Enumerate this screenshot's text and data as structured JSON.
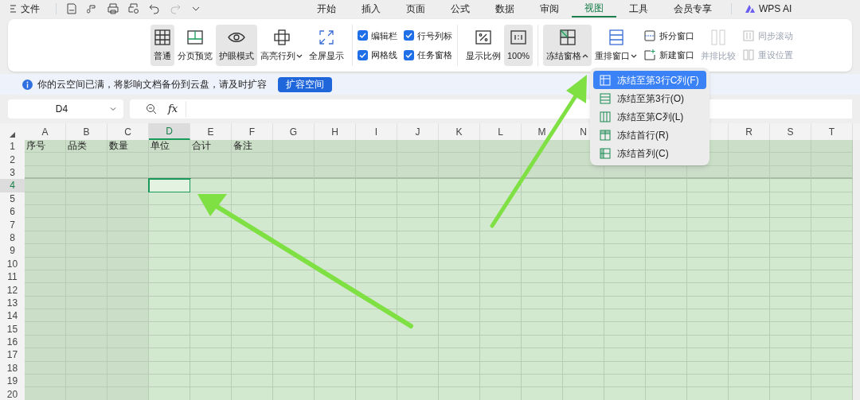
{
  "menubar": {
    "file_label": "文件",
    "tabs": [
      {
        "label": "开始",
        "selected": false
      },
      {
        "label": "插入",
        "selected": false
      },
      {
        "label": "页面",
        "selected": false
      },
      {
        "label": "公式",
        "selected": false
      },
      {
        "label": "数据",
        "selected": false
      },
      {
        "label": "审阅",
        "selected": false
      },
      {
        "label": "视图",
        "selected": true
      },
      {
        "label": "工具",
        "selected": false
      },
      {
        "label": "会员专享",
        "selected": false
      }
    ],
    "ai_label": "WPS AI"
  },
  "ribbon": {
    "view_buttons": [
      {
        "kind": "grid",
        "label": "普通",
        "selected": true,
        "dropdown": false
      },
      {
        "kind": "page",
        "label": "分页预览",
        "selected": false,
        "dropdown": false
      },
      {
        "kind": "eye",
        "label": "护眼模式",
        "selected": true,
        "dropdown": false
      },
      {
        "kind": "cross",
        "label": "高亮行列",
        "selected": false,
        "dropdown": true
      },
      {
        "kind": "expand",
        "label": "全屏显示",
        "selected": false,
        "dropdown": false
      }
    ],
    "checkboxes": [
      {
        "label": "编辑栏",
        "checked": true
      },
      {
        "label": "网格线",
        "checked": true
      },
      {
        "label": "行号列标",
        "checked": true
      },
      {
        "label": "任务窗格",
        "checked": true
      }
    ],
    "zoom_buttons": [
      {
        "kind": "percent",
        "label": "显示比例",
        "selected": false
      },
      {
        "kind": "ratio",
        "label": "100%",
        "selected": true
      }
    ],
    "window_buttons": [
      {
        "kind": "freeze",
        "label": "冻结窗格",
        "selected": true,
        "dropdown": true,
        "expanded": true
      },
      {
        "kind": "arrange",
        "label": "重排窗口",
        "selected": false,
        "dropdown": true,
        "expanded": false
      }
    ],
    "small_buttons": [
      {
        "kind": "split",
        "label": "拆分窗口",
        "disabled": false
      },
      {
        "kind": "new",
        "label": "新建窗口",
        "disabled": false
      }
    ],
    "compare_button": {
      "label": "并排比较",
      "disabled": true
    },
    "small_buttons_2": [
      {
        "kind": "sync",
        "label": "同步滚动",
        "disabled": true
      },
      {
        "kind": "reset",
        "label": "重设位置",
        "disabled": true
      }
    ]
  },
  "notice": {
    "text": "你的云空间已满，将影响文档备份到云盘，请及时扩容",
    "button": "扩容空间"
  },
  "formula_bar": {
    "name_box": "D4",
    "fx": "fx"
  },
  "sheet": {
    "columns": [
      {
        "label": "A",
        "selected": false
      },
      {
        "label": "B",
        "selected": false
      },
      {
        "label": "C",
        "selected": false
      },
      {
        "label": "D",
        "selected": true
      },
      {
        "label": "E",
        "selected": false
      },
      {
        "label": "F",
        "selected": false
      },
      {
        "label": "G",
        "selected": false
      },
      {
        "label": "H",
        "selected": false
      },
      {
        "label": "I",
        "selected": false
      },
      {
        "label": "J",
        "selected": false
      },
      {
        "label": "K",
        "selected": false
      },
      {
        "label": "L",
        "selected": false
      },
      {
        "label": "M",
        "selected": false
      },
      {
        "label": "N",
        "selected": false
      },
      {},
      {},
      {},
      {
        "label": "R",
        "selected": false
      },
      {
        "label": "S",
        "selected": false
      },
      {
        "label": "T",
        "selected": false
      }
    ],
    "rows": [
      {
        "label": "1",
        "selected": false,
        "cells": [
          "序号",
          "品类",
          "数量",
          "单位",
          "合计",
          "备注"
        ]
      },
      {
        "label": "2",
        "selected": false
      },
      {
        "label": "3",
        "selected": false
      },
      {
        "label": "4",
        "selected": true
      },
      {
        "label": "5",
        "selected": false
      },
      {
        "label": "6",
        "selected": false
      },
      {
        "label": "7",
        "selected": false
      },
      {
        "label": "8",
        "selected": false
      },
      {
        "label": "9",
        "selected": false
      },
      {
        "label": "10",
        "selected": false
      },
      {
        "label": "11",
        "selected": false
      },
      {
        "label": "12",
        "selected": false
      },
      {
        "label": "13",
        "selected": false
      },
      {
        "label": "14",
        "selected": false
      },
      {
        "label": "15",
        "selected": false
      },
      {
        "label": "16",
        "selected": false
      },
      {
        "label": "17",
        "selected": false
      },
      {
        "label": "18",
        "selected": false
      },
      {
        "label": "19",
        "selected": false
      },
      {
        "label": "20",
        "selected": false
      }
    ]
  },
  "freeze_menu": [
    {
      "kind": "both",
      "label": "冻结至第3行C列(F)",
      "selected": true
    },
    {
      "kind": "rows",
      "label": "冻结至第3行(O)",
      "selected": false
    },
    {
      "kind": "cols",
      "label": "冻结至第C列(L)",
      "selected": false
    },
    {
      "kind": "first_row",
      "label": "冻结首行(R)",
      "selected": false
    },
    {
      "kind": "first_col",
      "label": "冻结首列(C)",
      "selected": false
    }
  ]
}
